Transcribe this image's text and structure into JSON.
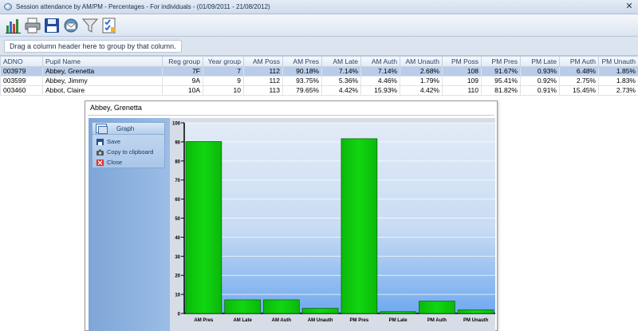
{
  "window": {
    "title": "Session attendance by AM/PM - Percentages - For individuals - (01/09/2011 - 21/08/2012)",
    "close_label": "✕"
  },
  "toolbar": {
    "buttons": [
      "chart-icon",
      "print-icon",
      "save-icon",
      "email-icon",
      "filter-icon",
      "checklist-icon"
    ]
  },
  "groupbar": {
    "hint": "Drag a column header here to group by that column."
  },
  "grid": {
    "columns": [
      "ADNO",
      "Pupil Name",
      "Reg group",
      "Year group",
      "AM Poss",
      "AM Pres",
      "AM Late",
      "AM Auth",
      "AM Unauth",
      "PM Poss",
      "PM Pres",
      "PM Late",
      "PM Auth",
      "PM Unauth"
    ],
    "rows": [
      [
        "003979",
        "Abbey, Grenetta",
        "7F",
        "7",
        "112",
        "90.18%",
        "7.14%",
        "7.14%",
        "2.68%",
        "108",
        "91.67%",
        "0.93%",
        "6.48%",
        "1.85%"
      ],
      [
        "003599",
        "Abbey, Jimmy",
        "9A",
        "9",
        "112",
        "93.75%",
        "5.36%",
        "4.46%",
        "1.79%",
        "109",
        "95.41%",
        "0.92%",
        "2.75%",
        "1.83%"
      ],
      [
        "003460",
        "Abbot, Claire",
        "10A",
        "10",
        "113",
        "79.65%",
        "4.42%",
        "15.93%",
        "4.42%",
        "110",
        "81.82%",
        "0.91%",
        "15.45%",
        "2.73%"
      ]
    ],
    "selected_row": 0
  },
  "popup": {
    "title": "Abbey, Grenetta",
    "side": {
      "header": "Graph",
      "items": [
        {
          "label": "Save",
          "icon": "save-icon"
        },
        {
          "label": "Copy to clipboard",
          "icon": "camera-icon"
        },
        {
          "label": "Close",
          "icon": "close-icon"
        }
      ]
    }
  },
  "chart_data": {
    "type": "bar",
    "categories": [
      "AM Pres",
      "AM Late",
      "AM Auth",
      "AM Unauth",
      "PM Pres",
      "PM Late",
      "PM Auth",
      "PM Unauth"
    ],
    "values": [
      90.18,
      7.14,
      7.14,
      2.68,
      91.67,
      0.93,
      6.48,
      1.85
    ],
    "ylim": [
      0,
      100
    ],
    "yticks": [
      0,
      10,
      20,
      30,
      40,
      50,
      60,
      70,
      80,
      90,
      100
    ],
    "grid": true,
    "bar_color": "#11d611",
    "background": "#6fa9ef"
  }
}
